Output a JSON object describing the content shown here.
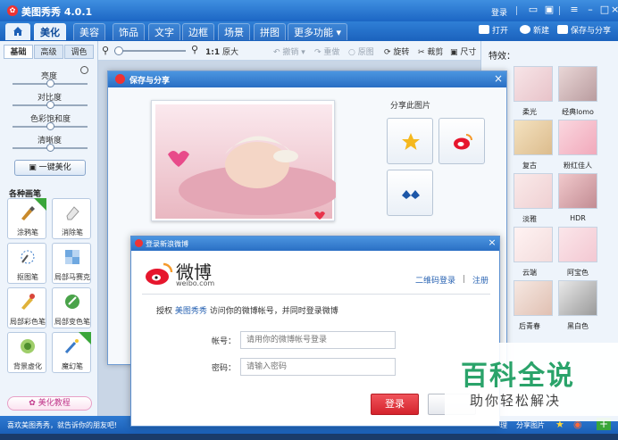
{
  "app": {
    "title": "美图秀秀 4.0.1"
  },
  "titlebar": {
    "login": "登录"
  },
  "menu": {
    "tabs": [
      {
        "label": "美化",
        "active": true
      },
      {
        "label": "美容"
      },
      {
        "label": "饰品"
      },
      {
        "label": "文字"
      },
      {
        "label": "边框"
      },
      {
        "label": "场景"
      },
      {
        "label": "拼图"
      },
      {
        "label": "更多功能"
      }
    ],
    "open": "打开",
    "new": "新建",
    "save_share": "保存与分享"
  },
  "left": {
    "subtabs": [
      "基础",
      "高级",
      "调色"
    ],
    "sliders": [
      {
        "label": "亮度",
        "value": 0.5
      },
      {
        "label": "对比度",
        "value": 0.5
      },
      {
        "label": "色彩饱和度",
        "value": 0.5
      },
      {
        "label": "清晰度",
        "value": 0.5
      }
    ],
    "onekey": "一键美化",
    "brushes_title": "各种画笔",
    "tools": [
      {
        "label": "涂鸦笔",
        "badge": "升级"
      },
      {
        "label": "消除笔"
      },
      {
        "label": "抠图笔"
      },
      {
        "label": "局部马赛克"
      },
      {
        "label": "局部彩色笔"
      },
      {
        "label": "局部变色笔"
      },
      {
        "label": "背景虚化"
      },
      {
        "label": "魔幻笔",
        "badge": "NEW"
      }
    ],
    "tutorial": "美化教程"
  },
  "toolbar": {
    "zoom_ratio": "1:1",
    "original_size": "原大",
    "undo": "撤销",
    "redo": "重做",
    "original": "原图",
    "rotate": "旋转",
    "crop": "裁剪",
    "size": "尺寸"
  },
  "effects": {
    "title": "特效：",
    "items": [
      "柔光",
      "经典lomo",
      "复古",
      "粉红佳人",
      "淡雅",
      "HDR",
      "云端",
      "阿宝色",
      "后青春",
      "黑白色"
    ]
  },
  "share_dialog": {
    "title": "保存与分享",
    "share_to": "分享此图片"
  },
  "weibo_dialog": {
    "title": "登录新浪微博",
    "brand": "微博",
    "brand_url": "weibo.com",
    "qr_login": "二维码登录",
    "register": "注册",
    "auth_prefix": "授权",
    "auth_app": "美图秀秀",
    "auth_suffix": "访问你的微博帐号，并同时登录微博",
    "account_label": "帐号：",
    "account_placeholder": "请用你的微博帐号登录",
    "password_label": "密码：",
    "password_placeholder": "请输入密码",
    "login_button": "登录"
  },
  "status": {
    "text": "喜欢美图秀秀，就告诉你的朋友吧!",
    "share_pic": "分享图片",
    "manage": "理"
  },
  "watermark": {
    "main": "百科全说",
    "sub": "助你轻松解决"
  },
  "colors": {
    "accent_blue": "#1c66c4",
    "weibo_red": "#e6162d",
    "watermark_green": "#2aa36a"
  }
}
